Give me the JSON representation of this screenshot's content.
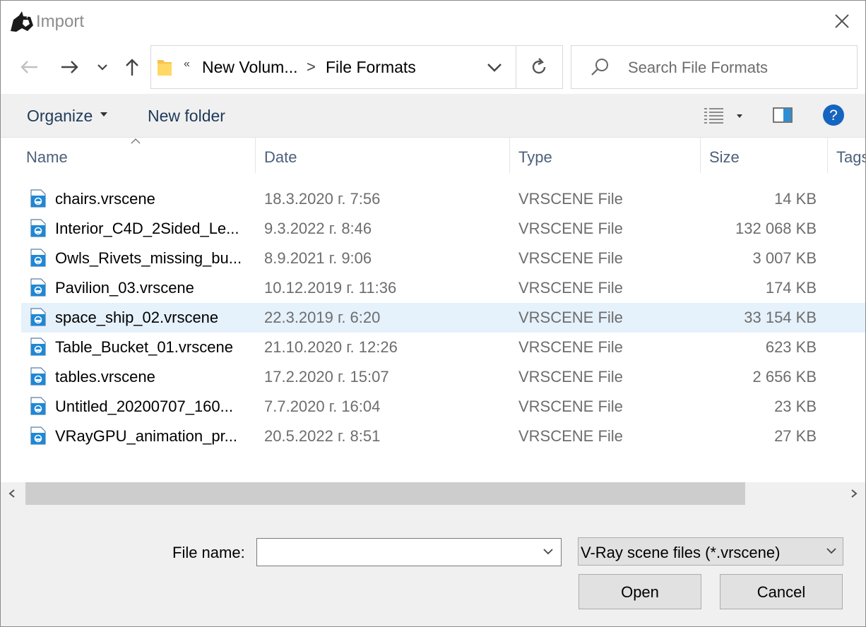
{
  "window": {
    "title": "Import"
  },
  "nav": {
    "address": {
      "overflow": "«",
      "segments": [
        "New Volum...",
        "File Formats"
      ],
      "separator": ">"
    }
  },
  "search": {
    "placeholder": "Search File Formats"
  },
  "toolbar": {
    "organize": "Organize",
    "new_folder": "New folder",
    "help": "?"
  },
  "columns": {
    "name": "Name",
    "date": "Date",
    "type": "Type",
    "size": "Size",
    "tags": "Tags"
  },
  "files": [
    {
      "name": "chairs.vrscene",
      "date": "18.3.2020 г. 7:56",
      "type": "VRSCENE File",
      "size": "14 KB"
    },
    {
      "name": "Interior_C4D_2Sided_Le...",
      "date": "9.3.2022 г. 8:46",
      "type": "VRSCENE File",
      "size": "132 068 KB"
    },
    {
      "name": "Owls_Rivets_missing_bu...",
      "date": "8.9.2021 г. 9:06",
      "type": "VRSCENE File",
      "size": "3 007 KB"
    },
    {
      "name": "Pavilion_03.vrscene",
      "date": "10.12.2019 г. 11:36",
      "type": "VRSCENE File",
      "size": "174 KB"
    },
    {
      "name": "space_ship_02.vrscene",
      "date": "22.3.2019 г. 6:20",
      "type": "VRSCENE File",
      "size": "33 154 KB",
      "selected": true
    },
    {
      "name": "Table_Bucket_01.vrscene",
      "date": "21.10.2020 г. 12:26",
      "type": "VRSCENE File",
      "size": "623 KB"
    },
    {
      "name": "tables.vrscene",
      "date": "17.2.2020 г. 15:07",
      "type": "VRSCENE File",
      "size": "2 656 KB"
    },
    {
      "name": "Untitled_20200707_160...",
      "date": "7.7.2020 г. 16:04",
      "type": "VRSCENE File",
      "size": "23 KB"
    },
    {
      "name": "VRayGPU_animation_pr...",
      "date": "20.5.2022 г. 8:51",
      "type": "VRSCENE File",
      "size": "27 KB"
    }
  ],
  "bottom": {
    "file_name_label": "File name:",
    "file_name_value": "",
    "filter": "V-Ray scene files (*.vrscene)",
    "open": "Open",
    "cancel": "Cancel"
  },
  "colors": {
    "accent": "#0078d7",
    "selection": "#e5f1fb",
    "link_text": "#1e3a5a",
    "header_text": "#4c607a"
  }
}
